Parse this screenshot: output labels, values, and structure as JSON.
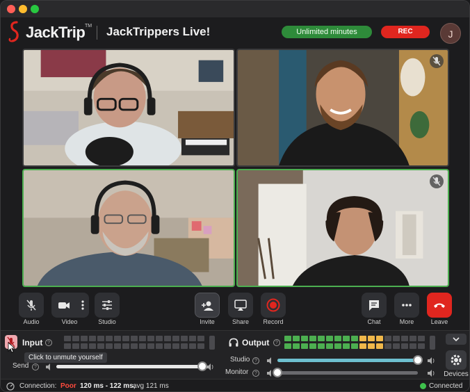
{
  "app": {
    "logo_text": "JackTrip",
    "trademark": "TM",
    "studio_name": "JackTrippers Live!",
    "minutes_badge": "Unlimited minutes",
    "rec_badge": "REC",
    "user_initial": "J"
  },
  "toolbar": {
    "buttons": [
      {
        "label": "Audio",
        "icon": "mic-off-icon"
      },
      {
        "label": "Video",
        "icon": "video-camera-icon"
      },
      {
        "label": "Studio",
        "icon": "sliders-icon"
      },
      {
        "label": "Invite",
        "icon": "add-person-icon"
      },
      {
        "label": "Share",
        "icon": "screen-share-icon"
      },
      {
        "label": "Record",
        "icon": "record-icon"
      },
      {
        "label": "Chat",
        "icon": "chat-icon"
      },
      {
        "label": "More",
        "icon": "more-dots-icon"
      },
      {
        "label": "Leave",
        "icon": "hang-up-icon"
      }
    ]
  },
  "mixer": {
    "input_label": "Input",
    "output_label": "Output",
    "tooltip": "Click to unmute yourself",
    "send_label": "Send",
    "studio_label": "Studio",
    "monitor_label": "Monitor",
    "devices_label": "Devices",
    "help_glyph": "?",
    "send_level": 1.0,
    "studio_level": 1.0,
    "monitor_level": 0.0,
    "output_meter_green": 9,
    "output_meter_yellow": 3,
    "output_meter_total": 17,
    "input_meter_total": 17
  },
  "status": {
    "connection_label": "Connection:",
    "connection_quality": "Poor",
    "latency": "120 ms - 122 ms,",
    "latency_avg": "avg 121 ms",
    "connected": "Connected"
  },
  "colors": {
    "accent_green": "#4caf50",
    "rec_red": "#e0261f",
    "poor_red": "#ff4a3d",
    "slider_blue": "#6ec0d0",
    "meter_yellow": "#f0b84a"
  }
}
